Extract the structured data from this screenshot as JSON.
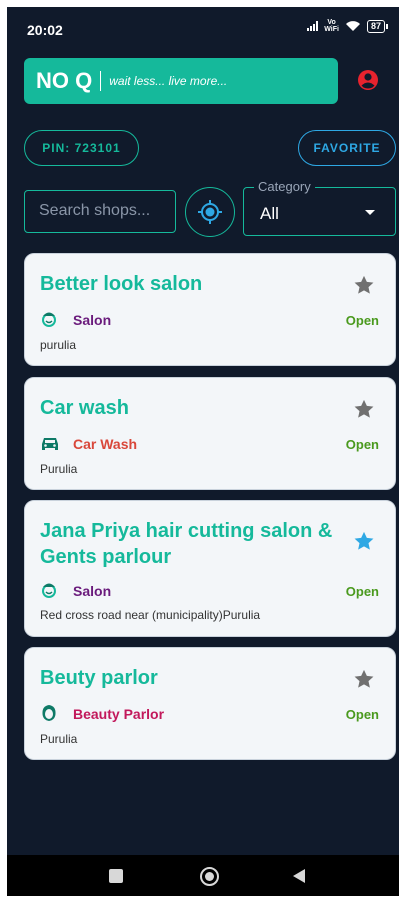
{
  "status_bar": {
    "time": "20:02",
    "network": "Vo WiFi",
    "battery": "87"
  },
  "header": {
    "title": "NO Q",
    "tagline": "wait less... live more..."
  },
  "pin_button": "PIN: 723101",
  "favorite_button": "FAVORITE",
  "search": {
    "placeholder": "Search shops..."
  },
  "category": {
    "label": "Category",
    "value": "All"
  },
  "shops": [
    {
      "name": "Better look salon",
      "category": "Salon",
      "status": "Open",
      "address": "purulia",
      "favorite": false
    },
    {
      "name": "Car wash",
      "category": "Car Wash",
      "status": "Open",
      "address": "Purulia",
      "favorite": false
    },
    {
      "name": "Jana Priya hair cutting salon & Gents parlour",
      "category": "Salon",
      "status": "Open",
      "address": "Red cross road near (municipality)Purulia",
      "favorite": true
    },
    {
      "name": "Beuty parlor",
      "category": "Beauty Parlor",
      "status": "Open",
      "address": "Purulia",
      "favorite": false
    }
  ],
  "colors": {
    "background": "#101a2b",
    "accent": "#15b99b",
    "favorite_blue": "#2ea8e4",
    "profile_red": "#e8232e",
    "open_green": "#4a9a1e",
    "salon_purple": "#6a1b7c",
    "car_wash_red": "#d9473a",
    "beauty_pink": "#c2185b"
  },
  "icons": {
    "profile": "account-circle-icon",
    "locate": "gps-locate-icon",
    "star": "star-icon",
    "salon": "face-icon",
    "car_wash": "car-icon",
    "beauty": "woman-face-icon"
  }
}
